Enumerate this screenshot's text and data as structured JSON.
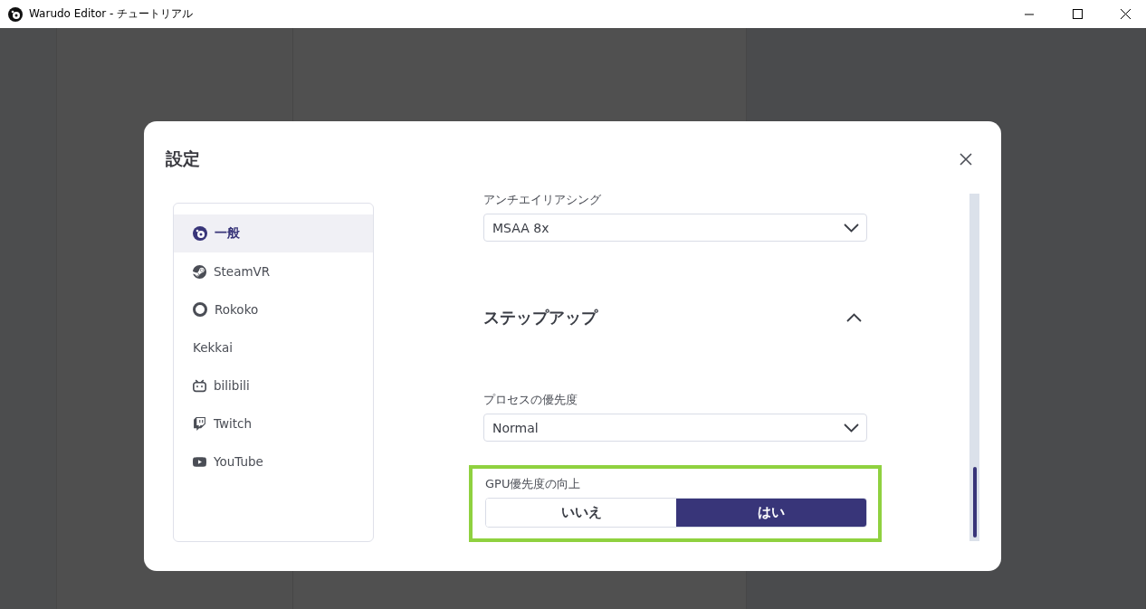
{
  "window": {
    "title": "Warudo Editor - チュートリアル"
  },
  "dialog": {
    "title": "設定",
    "nav_items": [
      {
        "label": "一般",
        "selected": true
      },
      {
        "label": "SteamVR",
        "selected": false
      },
      {
        "label": "Rokoko",
        "selected": false
      },
      {
        "label": "Kekkai",
        "selected": false
      },
      {
        "label": "bilibili",
        "selected": false
      },
      {
        "label": "Twitch",
        "selected": false
      },
      {
        "label": "YouTube",
        "selected": false
      }
    ],
    "content": [
      {
        "kind": "select",
        "label": "アンチエイリアシング",
        "value": "MSAA 8x"
      },
      {
        "kind": "heading",
        "label": "ステップアップ",
        "expanded": true
      },
      {
        "kind": "select",
        "label": "プロセスの優先度",
        "value": "Normal"
      },
      {
        "kind": "toggle",
        "label": "GPU優先度の向上",
        "highlighted": true,
        "options": [
          {
            "label": "いいえ",
            "selected": false
          },
          {
            "label": "はい",
            "selected": true
          }
        ]
      }
    ]
  }
}
